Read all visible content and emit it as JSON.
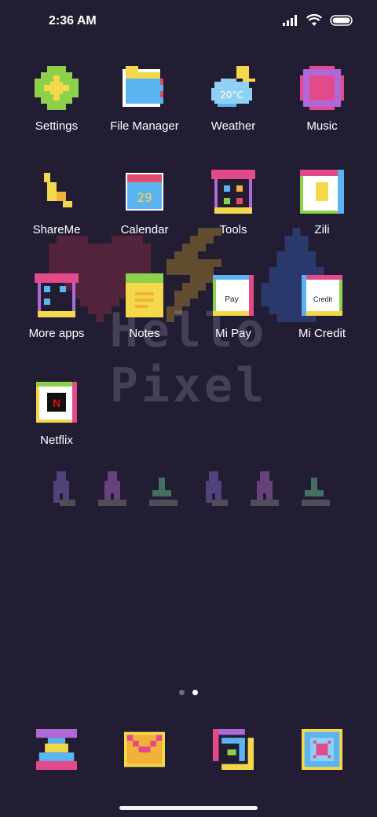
{
  "status_bar": {
    "time": "2:36 AM",
    "icons": [
      "signal-icon",
      "wifi-icon",
      "battery-icon"
    ]
  },
  "wallpaper": {
    "text": "Hello Pixel"
  },
  "apps": [
    {
      "label": "Settings",
      "icon": "settings-icon"
    },
    {
      "label": "File Manager",
      "icon": "folder-icon"
    },
    {
      "label": "Weather",
      "icon": "weather-icon",
      "temp": "20°C"
    },
    {
      "label": "Music",
      "icon": "music-icon"
    },
    {
      "label": "ShareMe",
      "icon": "shareme-icon"
    },
    {
      "label": "Calendar",
      "icon": "calendar-icon",
      "day": "29"
    },
    {
      "label": "Tools",
      "icon": "tools-icon"
    },
    {
      "label": "Zili",
      "icon": "zili-icon"
    },
    {
      "label": "More apps",
      "icon": "more-apps-icon"
    },
    {
      "label": "Notes",
      "icon": "notes-icon"
    },
    {
      "label": "Mi Pay",
      "icon": "mi-pay-icon",
      "badge": "Pay"
    },
    {
      "label": "Mi Credit",
      "icon": "mi-credit-icon",
      "badge": "Credit"
    },
    {
      "label": "Netflix",
      "icon": "netflix-icon",
      "letter": "N"
    }
  ],
  "page_indicator": {
    "count": 2,
    "active": 2
  },
  "dock": [
    {
      "icon": "phone-icon"
    },
    {
      "icon": "messages-icon"
    },
    {
      "icon": "browser-icon"
    },
    {
      "icon": "camera-icon"
    }
  ]
}
